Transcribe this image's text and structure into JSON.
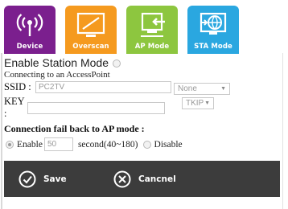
{
  "tabs": [
    {
      "label": "Device",
      "icon": "wifi-antenna-icon",
      "color": "#7b1f8e"
    },
    {
      "label": "Overscan",
      "icon": "overscan-icon",
      "color": "#f59a1f"
    },
    {
      "label": "AP Mode",
      "icon": "ap-mode-icon",
      "color": "#8dc63f"
    },
    {
      "label": "STA Mode",
      "icon": "sta-mode-icon",
      "color": "#2aa7e0"
    }
  ],
  "station": {
    "title": "Enable Station Mode",
    "status": "Connecting to an AccessPoint",
    "ssid_label": "SSID :",
    "ssid_value": "PC2TV",
    "security_value": "None",
    "key_label": "KEY :",
    "key_value": "",
    "encryption_value": "TKIP"
  },
  "fallback": {
    "heading": "Connection fail back to AP mode :",
    "enable_label": "Enable",
    "seconds_value": "50",
    "seconds_label": "second(40~180)",
    "disable_label": "Disable"
  },
  "actions": {
    "save_label": "Save",
    "cancel_label": "Cancnel"
  }
}
